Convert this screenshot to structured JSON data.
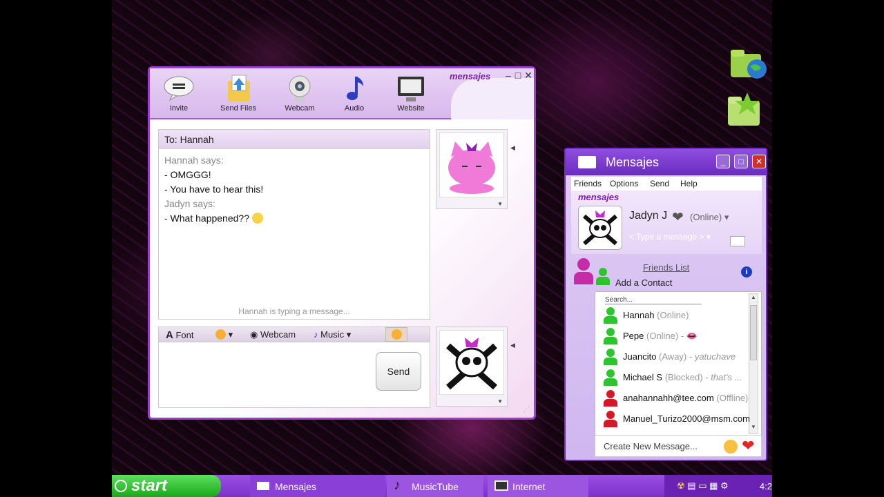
{
  "chat_window": {
    "brand": "mensajes",
    "toolbar": [
      {
        "label": "Invite",
        "icon": "speech-bubble-icon"
      },
      {
        "label": "Send Files",
        "icon": "send-files-icon"
      },
      {
        "label": "Webcam",
        "icon": "webcam-icon"
      },
      {
        "label": "Audio",
        "icon": "music-note-icon"
      },
      {
        "label": "Website",
        "icon": "monitor-icon"
      }
    ],
    "to_label": "To: ",
    "to_name": "Hannah",
    "messages": [
      {
        "speaker": "Hannah says:",
        "lines": [
          "- OMGGG!",
          "- You have to hear this!"
        ]
      },
      {
        "speaker": "Jadyn says:",
        "lines": [
          "- What happened??"
        ]
      }
    ],
    "typing_status": "Hannah is typing a message...",
    "format_bar": {
      "font": "Font",
      "webcam": "Webcam",
      "music": "Music"
    },
    "send_label": "Send"
  },
  "buddy_window": {
    "title": "Mensajes",
    "menu": [
      "Friends",
      "Options",
      "Send",
      "Help"
    ],
    "brand": "mensajes",
    "user_name": "Jadyn J",
    "user_status": "(Online)",
    "personal_message_placeholder": "< Type a message >",
    "friends_list_label": "Friends List",
    "add_contact_label": "Add a Contact",
    "search_placeholder": "Search...",
    "friends": [
      {
        "name": "Hannah",
        "status": "(Online)",
        "note": "",
        "color": "#2ec42e"
      },
      {
        "name": "Pepe",
        "status": "(Online) -",
        "note": "",
        "color": "#2ec42e"
      },
      {
        "name": "Juancito",
        "status": "(Away) -",
        "note": "yatuchave",
        "color": "#2ec42e"
      },
      {
        "name": "Michael S",
        "status": "(Blocked) -",
        "note": "that's ...",
        "color": "#2ec42e"
      },
      {
        "name": "anahannahh@tee.com",
        "status": "(Offline)",
        "note": "",
        "color": "#d01a2a"
      },
      {
        "name": "Manuel_Turizo2000@msm.com",
        "status": "",
        "note": "",
        "color": "#d01a2a"
      }
    ],
    "new_message_label": "Create New Message..."
  },
  "taskbar": {
    "start_label": "start",
    "items": [
      {
        "label": "Mensajes",
        "icon": "envelope-icon"
      },
      {
        "label": "MusicTube",
        "icon": "music-note-icon"
      },
      {
        "label": "Internet",
        "icon": "monitor-icon"
      }
    ],
    "clock": "4:2"
  },
  "colors": {
    "accent": "#8e4ee0",
    "online": "#2ec42e",
    "offline": "#d01a2a"
  }
}
